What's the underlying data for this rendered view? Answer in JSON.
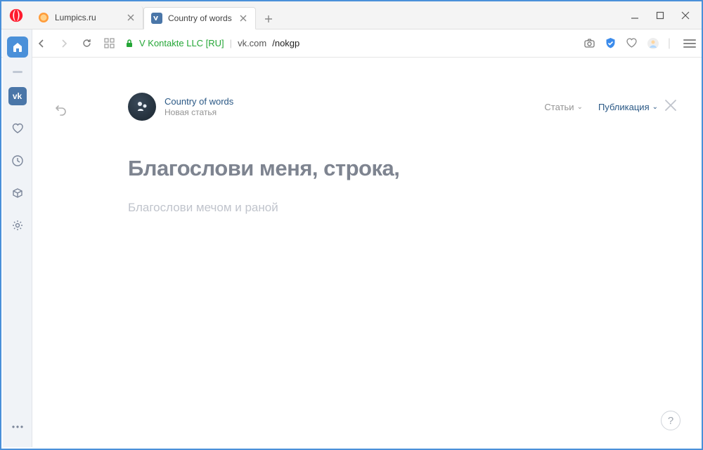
{
  "tabs": [
    {
      "title": "Lumpics.ru"
    },
    {
      "title": "Country of words"
    }
  ],
  "address": {
    "cert": "V Kontakte LLC [RU]",
    "host": "vk.com",
    "path": "/nokgp"
  },
  "editor": {
    "community_name": "Country of words",
    "subtitle": "Новая статья",
    "action_articles": "Статьи",
    "action_publish": "Публикация",
    "title": "Благослови меня, строка,",
    "body": "Благослови мечом и раной"
  }
}
